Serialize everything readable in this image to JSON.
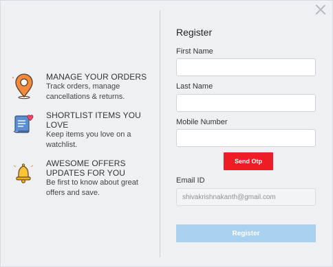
{
  "features": [
    {
      "icon": "map-pin-icon",
      "title": "MANAGE YOUR ORDERS",
      "desc": "Track orders, manage cancellations & returns."
    },
    {
      "icon": "shortlist-icon",
      "title": "SHORTLIST ITEMS YOU LOVE",
      "desc": "Keep items you love on a watchlist."
    },
    {
      "icon": "bell-icon",
      "title": "AWESOME OFFERS UPDATES FOR YOU",
      "desc": "Be first to know about great offers and save."
    }
  ],
  "form": {
    "title": "Register",
    "first_name_label": "First Name",
    "first_name_value": "",
    "last_name_label": "Last Name",
    "last_name_value": "",
    "mobile_label": "Mobile Number",
    "mobile_value": "",
    "send_otp_label": "Send Otp",
    "email_label": "Email ID",
    "email_value": "shivakrishnakanth@gmail.com",
    "register_label": "Register"
  },
  "colors": {
    "accent_red": "#ee1c25",
    "register_button": "#a9d0ef",
    "background": "#eef0f3"
  }
}
